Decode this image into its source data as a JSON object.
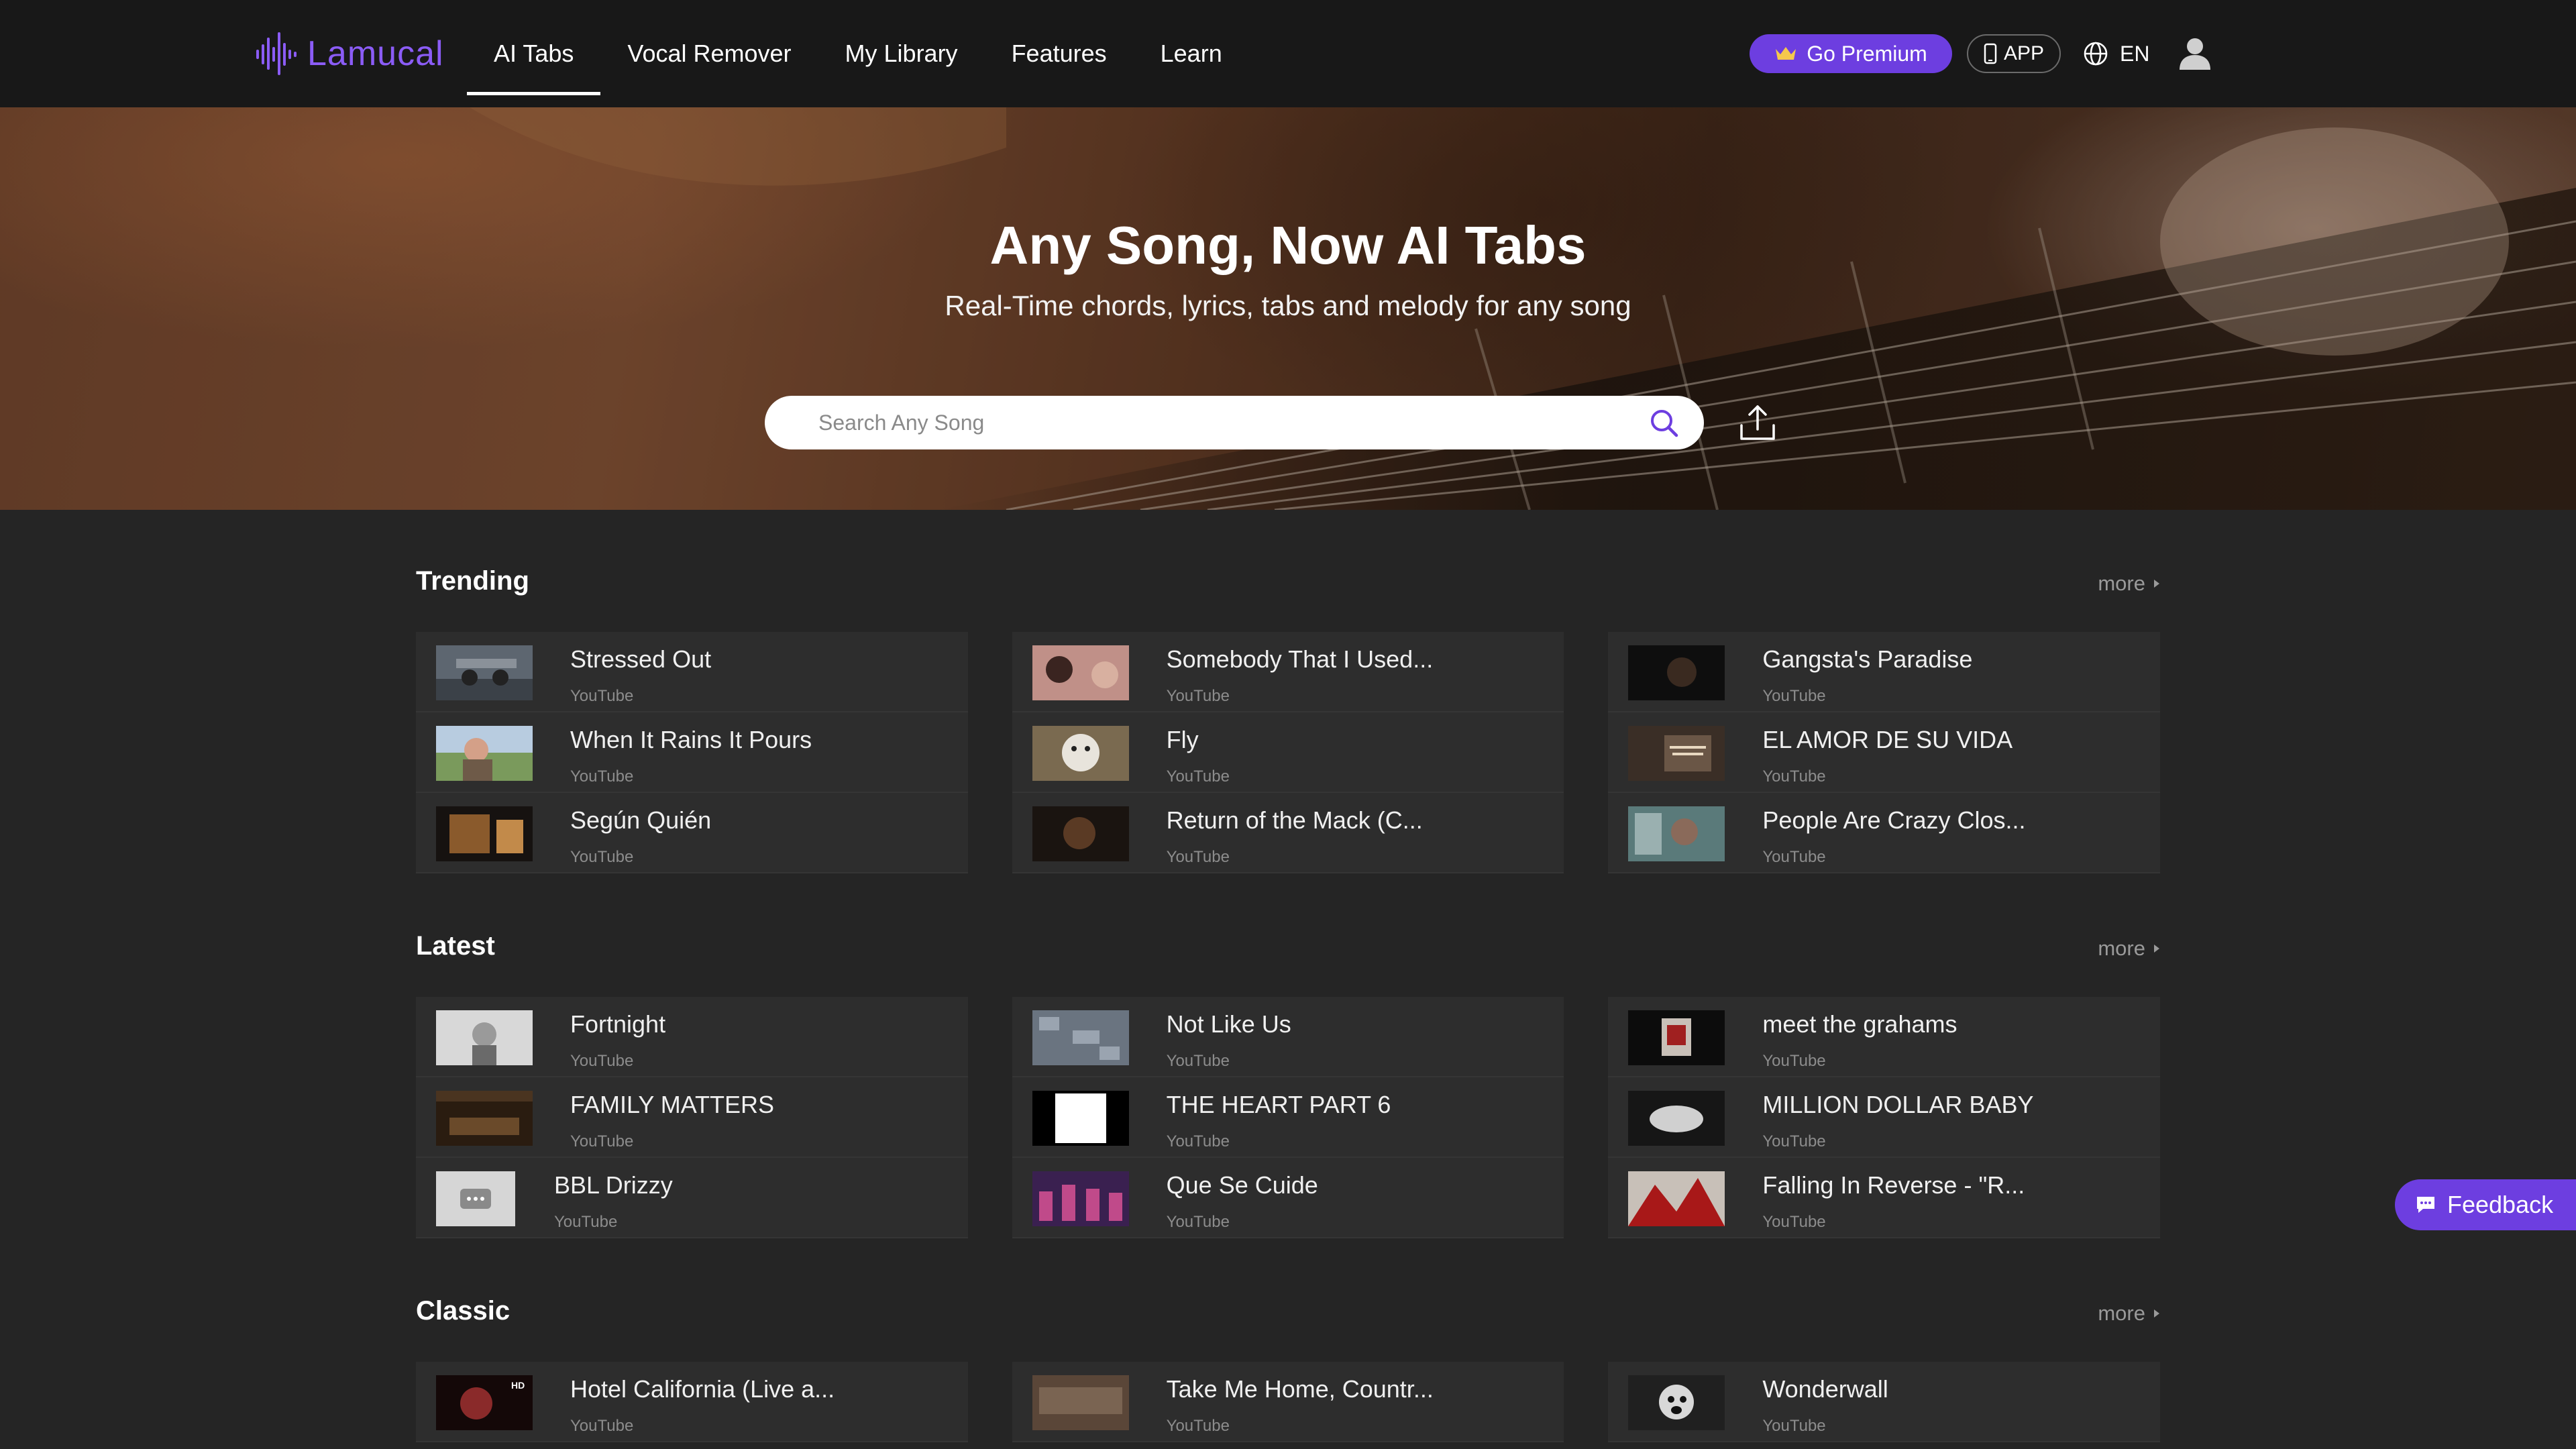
{
  "brand": {
    "name": "Lamucal",
    "accent": "#6d3ee0",
    "logo_color": "#8b5cf6"
  },
  "nav": {
    "items": [
      {
        "label": "AI Tabs",
        "active": true
      },
      {
        "label": "Vocal Remover",
        "active": false
      },
      {
        "label": "My Library",
        "active": false
      },
      {
        "label": "Features",
        "active": false
      },
      {
        "label": "Learn",
        "active": false
      }
    ],
    "premium_label": "Go Premium",
    "app_label": "APP",
    "lang_label": "EN",
    "icons": [
      "crown-icon",
      "phone-icon",
      "globe-icon",
      "user-icon"
    ]
  },
  "hero": {
    "title": "Any Song, Now AI Tabs",
    "subtitle": "Real-Time chords, lyrics, tabs and melody for any song",
    "search_placeholder": "Search Any Song",
    "icons": [
      "search-icon",
      "upload-icon"
    ]
  },
  "sections": [
    {
      "title": "Trending",
      "more_label": "more",
      "columns": [
        [
          {
            "title": "Stressed Out",
            "source": "YouTube"
          },
          {
            "title": "When It Rains It Pours",
            "source": "YouTube"
          },
          {
            "title": "Según Quién",
            "source": "YouTube"
          }
        ],
        [
          {
            "title": "Somebody That I Used...",
            "source": "YouTube"
          },
          {
            "title": "Fly",
            "source": "YouTube"
          },
          {
            "title": "Return of the Mack (C...",
            "source": "YouTube"
          }
        ],
        [
          {
            "title": "Gangsta's Paradise",
            "source": "YouTube"
          },
          {
            "title": "EL AMOR DE SU VIDA",
            "source": "YouTube"
          },
          {
            "title": "People Are Crazy Clos...",
            "source": "YouTube"
          }
        ]
      ]
    },
    {
      "title": "Latest",
      "more_label": "more",
      "columns": [
        [
          {
            "title": "Fortnight",
            "source": "YouTube"
          },
          {
            "title": "FAMILY MATTERS",
            "source": "YouTube"
          },
          {
            "title": "BBL Drizzy",
            "source": "YouTube"
          }
        ],
        [
          {
            "title": "Not Like Us",
            "source": "YouTube"
          },
          {
            "title": "THE HEART PART 6",
            "source": "YouTube"
          },
          {
            "title": "Que Se Cuide",
            "source": "YouTube"
          }
        ],
        [
          {
            "title": "meet the grahams",
            "source": "YouTube"
          },
          {
            "title": "MILLION DOLLAR BABY",
            "source": "YouTube"
          },
          {
            "title": "Falling In Reverse - \"R...",
            "source": "YouTube"
          }
        ]
      ]
    },
    {
      "title": "Classic",
      "more_label": "more",
      "columns": [
        [
          {
            "title": "Hotel California (Live a...",
            "source": "YouTube"
          }
        ],
        [
          {
            "title": "Take Me Home, Countr...",
            "source": "YouTube"
          }
        ],
        [
          {
            "title": "Wonderwall",
            "source": "YouTube"
          }
        ]
      ]
    }
  ],
  "feedback_label": "Feedback"
}
